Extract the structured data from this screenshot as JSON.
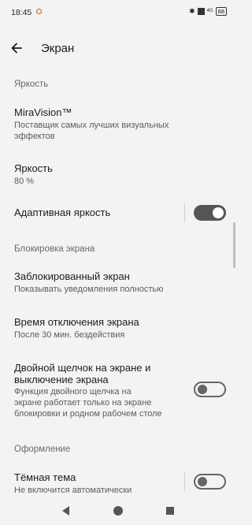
{
  "status": {
    "time": "18:45",
    "lte": "4G",
    "battery": "88"
  },
  "header": {
    "title": "Экран"
  },
  "sections": {
    "brightness": "Яркость",
    "lock": "Блокировка экрана",
    "style": "Оформление"
  },
  "items": {
    "miravision": {
      "title": "MiraVision™",
      "subtitle_1": "Поставщик самых лучших визуальных",
      "subtitle_2": "эффектов"
    },
    "brightness": {
      "title": "Яркость",
      "subtitle": "80 %"
    },
    "adaptive": {
      "title": "Адаптивная яркость",
      "state": "on"
    },
    "lockscreen": {
      "title": "Заблокированный экран",
      "subtitle": "Показывать уведомления полностью"
    },
    "timeout": {
      "title": "Время отключения экрана",
      "subtitle": "После 30 мин. бездействия"
    },
    "doubletap": {
      "title_1": "Двойной щелчок на экране и",
      "title_2": "выключение экрана",
      "subtitle_1": "Функция двойного щелчка на",
      "subtitle_2": "экране работает только на экране",
      "subtitle_3": "блокировки и родном рабочем столе",
      "state": "off"
    },
    "darktheme": {
      "title": "Тёмная тема",
      "subtitle": "Не включится автоматически",
      "state": "off"
    }
  },
  "colors": {
    "background": "#f3f3f3",
    "switch_on": "#555555",
    "accent_dot": "#e64a19"
  },
  "icons": {
    "back": "arrow-left-icon",
    "nav_back": "triangle-back-icon",
    "nav_home": "circle-home-icon",
    "nav_recent": "square-recent-icon"
  }
}
